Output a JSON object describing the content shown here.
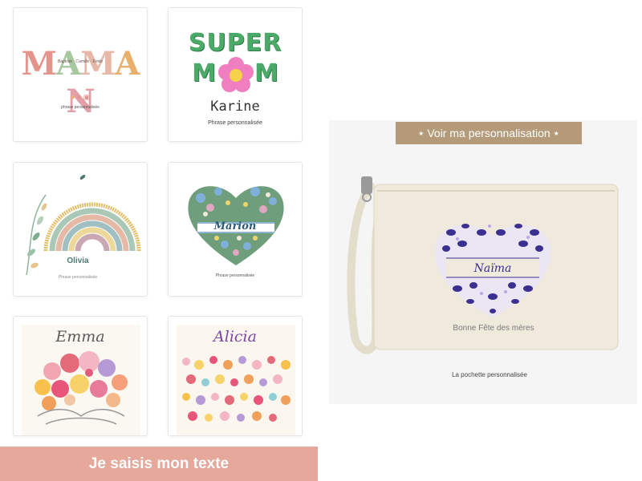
{
  "designs": [
    {
      "id": "maman",
      "title_letters": [
        "M",
        "A",
        "M",
        "A",
        "N"
      ],
      "letter_colors": [
        "#e4948a",
        "#a8c8a0",
        "#e7b8a8",
        "#e8b06c",
        "#e2a0a8"
      ],
      "kids_line": "Baptiste · Camille · Emile",
      "hearts": "☺ ♥ ♥",
      "phrase": "phrase personnalisée"
    },
    {
      "id": "super-mom",
      "line1": "SUPER",
      "mom_left": "M",
      "mom_right": "M",
      "name": "Karine",
      "phrase": "Phrase personnalisée"
    },
    {
      "id": "rainbow",
      "name": "Olivia",
      "phrase": "Phrase personnalisée"
    },
    {
      "id": "flower-heart",
      "name": "Marion",
      "phrase": "Phrase personnalisée"
    },
    {
      "id": "bouquet",
      "name": "Emma"
    },
    {
      "id": "flower-meadow",
      "name": "Alicia"
    }
  ],
  "cta": {
    "label": "Je saisis mon texte"
  },
  "preview": {
    "button_label": "Voir ma personnalisation",
    "star_icon": "★",
    "pouch_name": "Naïma",
    "pouch_phrase": "Bonne Fête des mères",
    "caption": "La pochette personnalisée",
    "pouch_color": "#efeadc",
    "leopard_color": "#3b2f8f"
  }
}
